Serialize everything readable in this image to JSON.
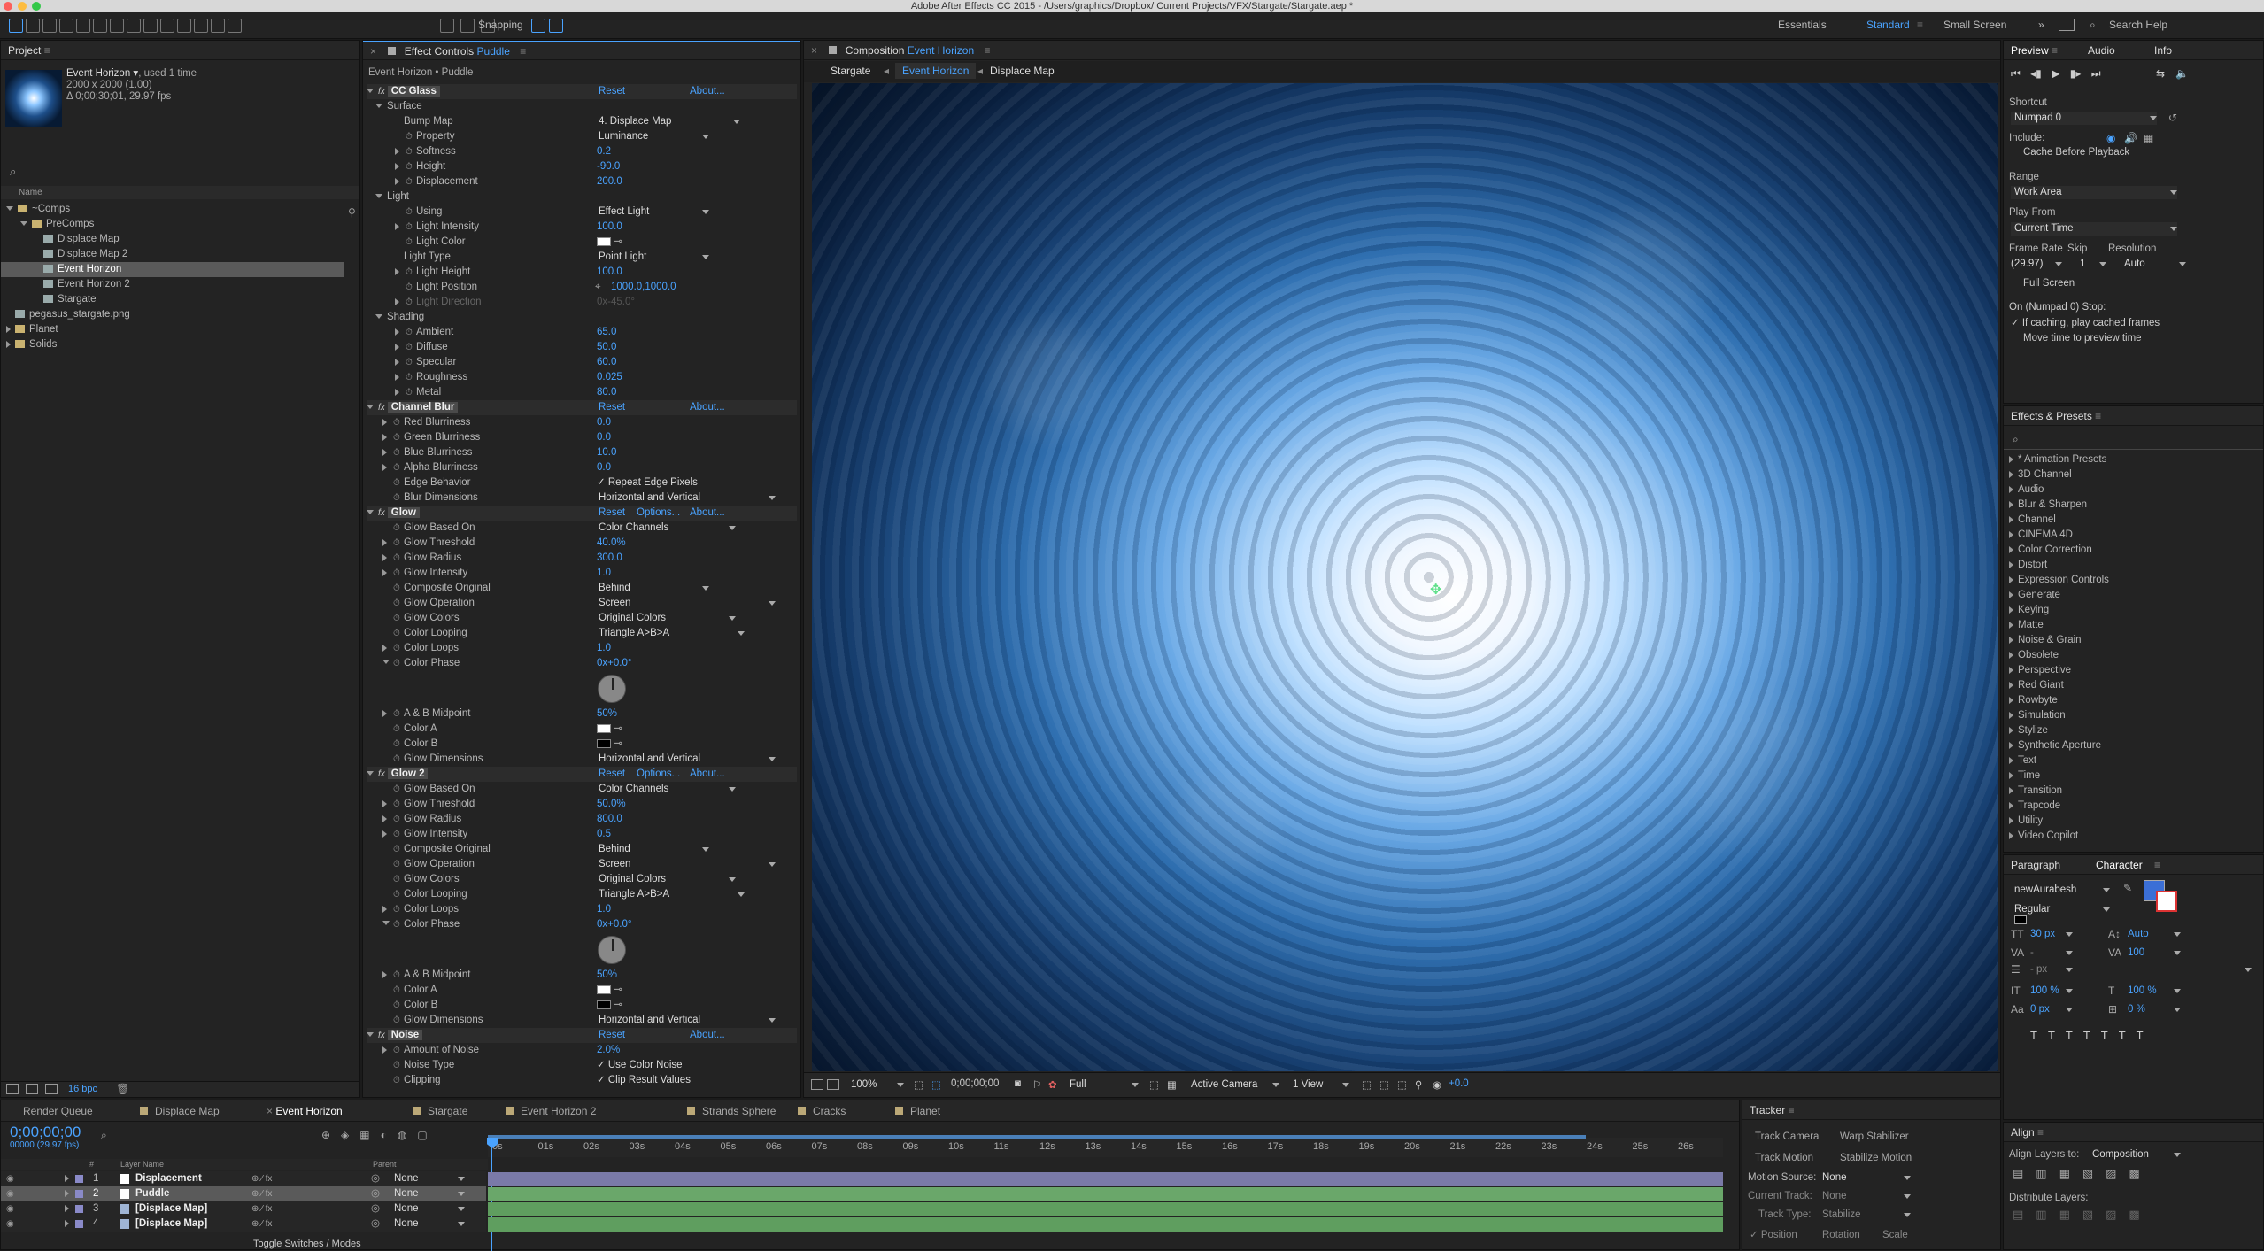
{
  "titlebar": {
    "title": "Adobe After Effects CC 2015 - /Users/graphics/Dropbox/ Current Projects/VFX/Stargate/Stargate.aep *"
  },
  "toolbar": {
    "snapping": "Snapping",
    "workspaces": [
      "Essentials",
      "Standard",
      "Small Screen"
    ],
    "active_workspace": "Standard",
    "search_help": "Search Help"
  },
  "project": {
    "title": "Project",
    "item_name": "Event Horizon ▾",
    "used": ", used 1 time",
    "dims": "2000 x 2000 (1.00)",
    "duration": "Δ 0;00;30;01, 29.97 fps",
    "column_name": "Name",
    "tree": [
      {
        "label": "~Comps",
        "depth": 0,
        "open": true
      },
      {
        "label": "PreComps",
        "depth": 1,
        "open": true
      },
      {
        "label": "Displace Map",
        "depth": 2
      },
      {
        "label": "Displace Map 2",
        "depth": 2
      },
      {
        "label": "Event Horizon",
        "depth": 2,
        "selected": true
      },
      {
        "label": "Event Horizon 2",
        "depth": 2
      },
      {
        "label": "Stargate",
        "depth": 2
      },
      {
        "label": "pegasus_stargate.png",
        "depth": 0
      },
      {
        "label": "Planet",
        "depth": 0,
        "closed": true
      },
      {
        "label": "Solids",
        "depth": 0,
        "closed": true
      }
    ],
    "bpc": "16 bpc"
  },
  "effects": {
    "title": "Effect Controls",
    "layer": "Puddle",
    "path": "Event Horizon • Puddle",
    "rows": [
      {
        "t": "fx",
        "name": "CC Glass",
        "reset": "Reset",
        "about": "About..."
      },
      {
        "t": "grp",
        "name": "Surface",
        "d": 1
      },
      {
        "t": "p",
        "name": "Bump Map",
        "d": 2,
        "dd": "4. Displace Map",
        "ddw": 160
      },
      {
        "t": "p",
        "name": "Property",
        "d": 3,
        "sw": true,
        "dd": "Luminance",
        "ddw": 125
      },
      {
        "t": "p",
        "name": "Softness",
        "d": 3,
        "sw": true,
        "v": "0.2",
        "tri": true
      },
      {
        "t": "p",
        "name": "Height",
        "d": 3,
        "sw": true,
        "v": "-90.0",
        "tri": true
      },
      {
        "t": "p",
        "name": "Displacement",
        "d": 3,
        "sw": true,
        "v": "200.0",
        "tri": true
      },
      {
        "t": "grp",
        "name": "Light",
        "d": 1
      },
      {
        "t": "p",
        "name": "Using",
        "d": 3,
        "sw": true,
        "dd": "Effect Light",
        "ddw": 125
      },
      {
        "t": "p",
        "name": "Light Intensity",
        "d": 3,
        "sw": true,
        "v": "100.0",
        "tri": true
      },
      {
        "t": "p",
        "name": "Light Color",
        "d": 3,
        "sw": true,
        "color": "#ffffff"
      },
      {
        "t": "p",
        "name": "Light Type",
        "d": 2,
        "dd": "Point Light",
        "ddw": 125
      },
      {
        "t": "p",
        "name": "Light Height",
        "d": 3,
        "sw": true,
        "v": "100.0",
        "tri": true
      },
      {
        "t": "p",
        "name": "Light Position",
        "d": 3,
        "sw": true,
        "v": "1000.0,1000.0",
        "target": true
      },
      {
        "t": "p",
        "name": "Light Direction",
        "d": 3,
        "sw": true,
        "v": "0x-45.0°",
        "dim": true,
        "tri": true
      },
      {
        "t": "grp",
        "name": "Shading",
        "d": 1
      },
      {
        "t": "p",
        "name": "Ambient",
        "d": 3,
        "sw": true,
        "v": "65.0",
        "tri": true
      },
      {
        "t": "p",
        "name": "Diffuse",
        "d": 3,
        "sw": true,
        "v": "50.0",
        "tri": true
      },
      {
        "t": "p",
        "name": "Specular",
        "d": 3,
        "sw": true,
        "v": "60.0",
        "tri": true
      },
      {
        "t": "p",
        "name": "Roughness",
        "d": 3,
        "sw": true,
        "v": "0.025",
        "tri": true
      },
      {
        "t": "p",
        "name": "Metal",
        "d": 3,
        "sw": true,
        "v": "80.0",
        "tri": true
      },
      {
        "t": "fx",
        "name": "Channel Blur",
        "reset": "Reset",
        "about": "About..."
      },
      {
        "t": "p",
        "name": "Red Blurriness",
        "d": 2,
        "sw": true,
        "v": "0.0",
        "tri": true
      },
      {
        "t": "p",
        "name": "Green Blurriness",
        "d": 2,
        "sw": true,
        "v": "0.0",
        "tri": true
      },
      {
        "t": "p",
        "name": "Blue Blurriness",
        "d": 2,
        "sw": true,
        "v": "10.0",
        "tri": true
      },
      {
        "t": "p",
        "name": "Alpha Blurriness",
        "d": 2,
        "sw": true,
        "v": "0.0",
        "tri": true
      },
      {
        "t": "p",
        "name": "Edge Behavior",
        "d": 2,
        "sw": true,
        "cb": "Repeat Edge Pixels"
      },
      {
        "t": "p",
        "name": "Blur Dimensions",
        "d": 2,
        "sw": true,
        "dd": "Horizontal and Vertical",
        "ddw": 200
      },
      {
        "t": "fx",
        "name": "Glow",
        "reset": "Reset",
        "options": "Options...",
        "about": "About..."
      },
      {
        "t": "p",
        "name": "Glow Based On",
        "d": 2,
        "sw": true,
        "dd": "Color Channels",
        "ddw": 155
      },
      {
        "t": "p",
        "name": "Glow Threshold",
        "d": 2,
        "sw": true,
        "v": "40.0%",
        "tri": true
      },
      {
        "t": "p",
        "name": "Glow Radius",
        "d": 2,
        "sw": true,
        "v": "300.0",
        "tri": true
      },
      {
        "t": "p",
        "name": "Glow Intensity",
        "d": 2,
        "sw": true,
        "v": "1.0",
        "tri": true
      },
      {
        "t": "p",
        "name": "Composite Original",
        "d": 2,
        "sw": true,
        "dd": "Behind",
        "ddw": 125
      },
      {
        "t": "p",
        "name": "Glow Operation",
        "d": 2,
        "sw": true,
        "dd": "Screen",
        "ddw": 200
      },
      {
        "t": "p",
        "name": "Glow Colors",
        "d": 2,
        "sw": true,
        "dd": "Original Colors",
        "ddw": 155
      },
      {
        "t": "p",
        "name": "Color Looping",
        "d": 2,
        "sw": true,
        "dd": "Triangle A>B>A",
        "ddw": 165
      },
      {
        "t": "p",
        "name": "Color Loops",
        "d": 2,
        "sw": true,
        "v": "1.0",
        "tri": true
      },
      {
        "t": "p",
        "name": "Color Phase",
        "d": 2,
        "sw": true,
        "v": "0x+0.0°",
        "open": true
      },
      {
        "t": "dial"
      },
      {
        "t": "p",
        "name": "A & B Midpoint",
        "d": 2,
        "sw": true,
        "v": "50%",
        "tri": true
      },
      {
        "t": "p",
        "name": "Color A",
        "d": 2,
        "sw": true,
        "color": "#ffffff"
      },
      {
        "t": "p",
        "name": "Color B",
        "d": 2,
        "sw": true,
        "color": "#000000"
      },
      {
        "t": "p",
        "name": "Glow Dimensions",
        "d": 2,
        "sw": true,
        "dd": "Horizontal and Vertical",
        "ddw": 200
      },
      {
        "t": "fx",
        "name": "Glow 2",
        "reset": "Reset",
        "options": "Options...",
        "about": "About..."
      },
      {
        "t": "p",
        "name": "Glow Based On",
        "d": 2,
        "sw": true,
        "dd": "Color Channels",
        "ddw": 155
      },
      {
        "t": "p",
        "name": "Glow Threshold",
        "d": 2,
        "sw": true,
        "v": "50.0%",
        "tri": true
      },
      {
        "t": "p",
        "name": "Glow Radius",
        "d": 2,
        "sw": true,
        "v": "800.0",
        "tri": true
      },
      {
        "t": "p",
        "name": "Glow Intensity",
        "d": 2,
        "sw": true,
        "v": "0.5",
        "tri": true
      },
      {
        "t": "p",
        "name": "Composite Original",
        "d": 2,
        "sw": true,
        "dd": "Behind",
        "ddw": 125
      },
      {
        "t": "p",
        "name": "Glow Operation",
        "d": 2,
        "sw": true,
        "dd": "Screen",
        "ddw": 200
      },
      {
        "t": "p",
        "name": "Glow Colors",
        "d": 2,
        "sw": true,
        "dd": "Original Colors",
        "ddw": 155
      },
      {
        "t": "p",
        "name": "Color Looping",
        "d": 2,
        "sw": true,
        "dd": "Triangle A>B>A",
        "ddw": 165
      },
      {
        "t": "p",
        "name": "Color Loops",
        "d": 2,
        "sw": true,
        "v": "1.0",
        "tri": true
      },
      {
        "t": "p",
        "name": "Color Phase",
        "d": 2,
        "sw": true,
        "v": "0x+0.0°",
        "open": true
      },
      {
        "t": "dial"
      },
      {
        "t": "p",
        "name": "A & B Midpoint",
        "d": 2,
        "sw": true,
        "v": "50%",
        "tri": true
      },
      {
        "t": "p",
        "name": "Color A",
        "d": 2,
        "sw": true,
        "color": "#ffffff"
      },
      {
        "t": "p",
        "name": "Color B",
        "d": 2,
        "sw": true,
        "color": "#000000"
      },
      {
        "t": "p",
        "name": "Glow Dimensions",
        "d": 2,
        "sw": true,
        "dd": "Horizontal and Vertical",
        "ddw": 200
      },
      {
        "t": "fx",
        "name": "Noise",
        "reset": "Reset",
        "about": "About..."
      },
      {
        "t": "p",
        "name": "Amount of Noise",
        "d": 2,
        "sw": true,
        "v": "2.0%",
        "tri": true
      },
      {
        "t": "p",
        "name": "Noise Type",
        "d": 2,
        "sw": true,
        "cb": "Use Color Noise"
      },
      {
        "t": "p",
        "name": "Clipping",
        "d": 2,
        "sw": true,
        "cb": "Clip Result Values"
      }
    ]
  },
  "composition": {
    "title": "Composition",
    "name": "Event Horizon",
    "crumbs": [
      "Stargate",
      "Event Horizon",
      "Displace Map"
    ],
    "footer": {
      "zoom": "100%",
      "time": "0;00;00;00",
      "resolution": "Full",
      "camera": "Active Camera",
      "views": "1 View",
      "exposure": "+0.0"
    }
  },
  "preview": {
    "tabs": [
      "Preview",
      "Audio",
      "Info"
    ],
    "shortcut_label": "Shortcut",
    "shortcut": "Numpad 0",
    "include": "Include:",
    "cache": "Cache Before Playback",
    "range_label": "Range",
    "range": "Work Area",
    "playfrom_label": "Play From",
    "playfrom": "Current Time",
    "fr_label": "Frame Rate",
    "skip_label": "Skip",
    "res_label": "Resolution",
    "fr": "(29.97)",
    "skip": "1",
    "res": "Auto",
    "fullscreen": "Full Screen",
    "stop_label": "On (Numpad 0) Stop:",
    "stop1": "If caching, play cached frames",
    "stop2": "Move time to preview time"
  },
  "presets": {
    "title": "Effects & Presets",
    "items": [
      "* Animation Presets",
      "3D Channel",
      "Audio",
      "Blur & Sharpen",
      "Channel",
      "CINEMA 4D",
      "Color Correction",
      "Distort",
      "Expression Controls",
      "Generate",
      "Keying",
      "Matte",
      "Noise & Grain",
      "Obsolete",
      "Perspective",
      "Red Giant",
      "Rowbyte",
      "Simulation",
      "Stylize",
      "Synthetic Aperture",
      "Text",
      "Time",
      "Transition",
      "Trapcode",
      "Utility",
      "Video Copilot"
    ]
  },
  "character": {
    "tabs": [
      "Paragraph",
      "Character"
    ],
    "font": "newAurabesh",
    "style": "Regular",
    "size": "30 px",
    "leading": "Auto",
    "kerning": "-",
    "tracking": "100",
    "stroke": "- px",
    "vscale": "100 %",
    "hscale": "100 %",
    "baseline": "0 px",
    "tsume": "0 %"
  },
  "align": {
    "title": "Align",
    "label": "Align Layers to:",
    "target": "Composition",
    "distribute": "Distribute Layers:"
  },
  "tracker": {
    "title": "Tracker",
    "b1": "Track Camera",
    "b2": "Warp Stabilizer",
    "b3": "Track Motion",
    "b4": "Stabilize Motion",
    "ms_label": "Motion Source:",
    "ms": "None",
    "ct_label": "Current Track:",
    "ct": "None",
    "tt_label": "Track Type:",
    "tt": "Stabilize",
    "pos": "Position",
    "rot": "Rotation",
    "scale": "Scale"
  },
  "timeline": {
    "tabs": [
      "Render Queue",
      "Displace Map",
      "Event Horizon",
      "Stargate",
      "Event Horizon 2",
      "Strands Sphere",
      "Cracks",
      "Planet"
    ],
    "active": "Event Horizon",
    "timecode": "0;00;00;00",
    "frames": "00000 (29.97 fps)",
    "col_layer": "Layer Name",
    "col_parent": "Parent",
    "col_num": "#",
    "toggle": "Toggle Switches / Modes",
    "ruler": [
      "0s",
      "01s",
      "02s",
      "03s",
      "04s",
      "05s",
      "06s",
      "07s",
      "08s",
      "09s",
      "10s",
      "11s",
      "12s",
      "13s",
      "14s",
      "15s",
      "16s",
      "17s",
      "18s",
      "19s",
      "20s",
      "21s",
      "22s",
      "23s",
      "24s",
      "25s",
      "26s"
    ],
    "layers": [
      {
        "num": "1",
        "name": "Displacement",
        "parent": "None",
        "color": "#ffffff",
        "bar": "#7a7aa8"
      },
      {
        "num": "2",
        "name": "Puddle",
        "parent": "None",
        "color": "#ffffff",
        "bar": "#6aa76a",
        "selected": true
      },
      {
        "num": "3",
        "name": "[Displace Map]",
        "parent": "None",
        "color": "#9fb5d5",
        "bar": "#5f9e5f"
      },
      {
        "num": "4",
        "name": "[Displace Map]",
        "parent": "None",
        "color": "#9fb5d5",
        "bar": "#5f9e5f"
      }
    ]
  }
}
